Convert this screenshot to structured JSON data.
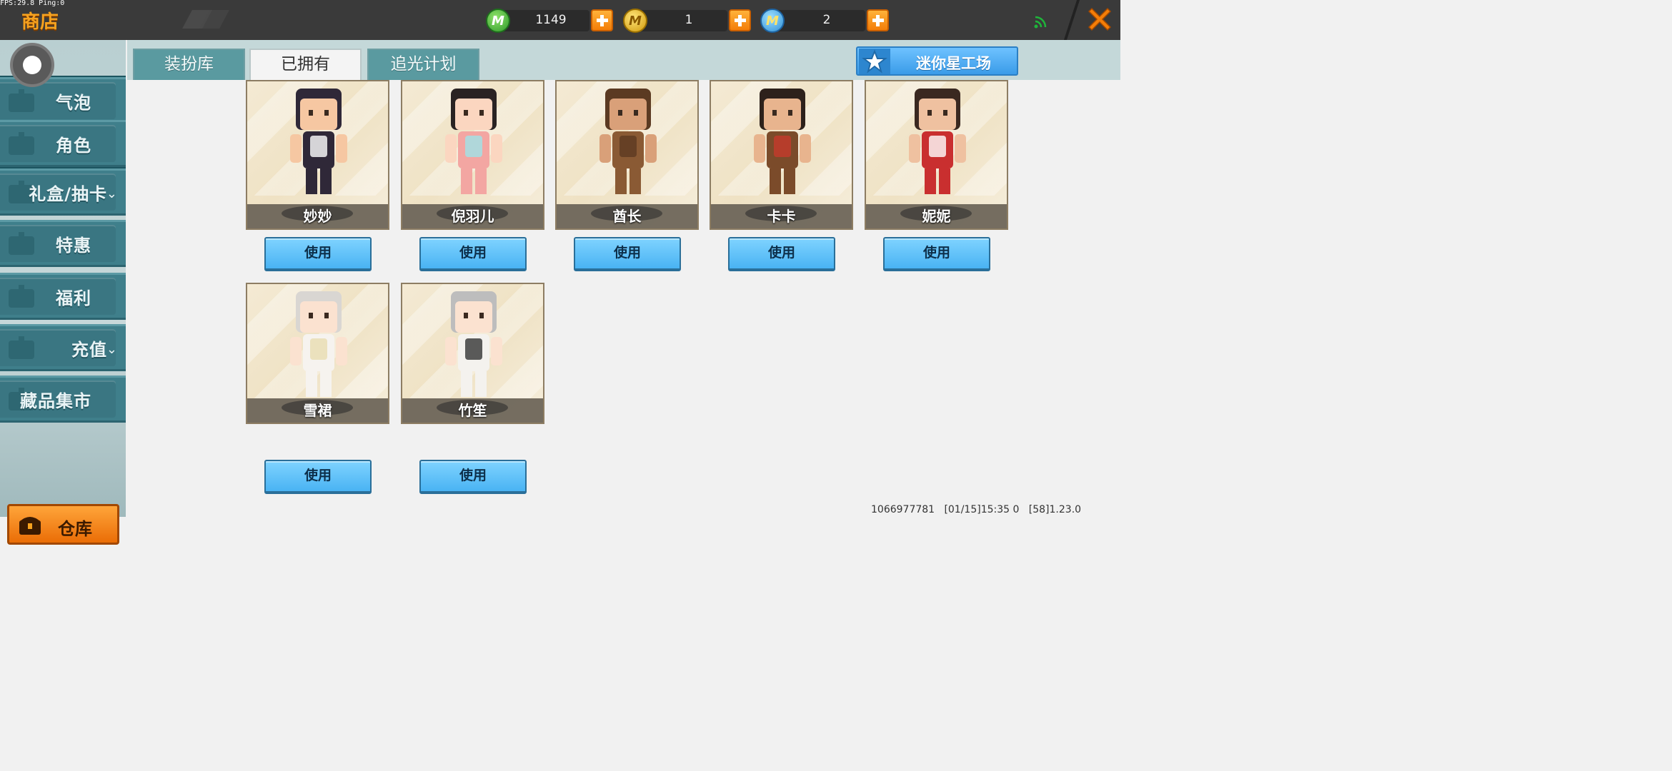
{
  "debug": {
    "fps_text": "FPS:29.8  Ping:0"
  },
  "header": {
    "title": "商店",
    "currencies": [
      {
        "icon": "green-gem-coin-icon",
        "letter": "M",
        "value": "1149",
        "color": "#3db53a"
      },
      {
        "icon": "gold-coin-icon",
        "letter": "M",
        "value": "1",
        "color": "#e8b417"
      },
      {
        "icon": "blue-coin-icon",
        "letter": "M",
        "value": "2",
        "color": "#3aa4e8"
      }
    ]
  },
  "sidebar": {
    "items": [
      {
        "label": "气泡",
        "icon": "gift-box-icon"
      },
      {
        "label": "角色",
        "icon": "character-icon"
      },
      {
        "label": "礼盒/抽卡",
        "icon": "lottery-wheel-icon",
        "expandable": true
      },
      {
        "label": "特惠",
        "icon": "gift-box-icon"
      },
      {
        "label": "福利",
        "icon": "gift-icon"
      },
      {
        "label": "充值",
        "icon": "coins-icon",
        "expandable": true
      },
      {
        "label": "藏品集市",
        "icon": "diamond-icon"
      }
    ],
    "warehouse_label": "仓库"
  },
  "tabs": {
    "items": [
      {
        "label": "装扮库"
      },
      {
        "label": "已拥有",
        "active": true
      },
      {
        "label": "追光计划"
      }
    ],
    "mini_studio_label": "迷你星工场"
  },
  "skins": [
    {
      "name": "妙妙",
      "use_label": "使用",
      "palette": {
        "skin": "#f6c7a2",
        "body": "#2f2838",
        "accent": "#ffffff",
        "hair": "#2f2838"
      }
    },
    {
      "name": "倪羽儿",
      "use_label": "使用",
      "palette": {
        "skin": "#fbd6c0",
        "body": "#f3a6a2",
        "accent": "#9fe3e8",
        "hair": "#2a2323"
      }
    },
    {
      "name": "酋长",
      "use_label": "使用",
      "palette": {
        "skin": "#d9a079",
        "body": "#8a5a34",
        "accent": "#5c3a22",
        "hair": "#5b3a22"
      }
    },
    {
      "name": "卡卡",
      "use_label": "使用",
      "palette": {
        "skin": "#e8b48e",
        "body": "#7b4b2a",
        "accent": "#c63a2c",
        "hair": "#2d211b"
      }
    },
    {
      "name": "妮妮",
      "use_label": "使用",
      "palette": {
        "skin": "#efc1a0",
        "body": "#c92f2f",
        "accent": "#ffffff",
        "hair": "#3a2820"
      }
    },
    {
      "name": "雪裙",
      "use_label": "使用",
      "palette": {
        "skin": "#fbe2d0",
        "body": "#f6f3ef",
        "accent": "#e9dcb0",
        "hair": "#d9d6d2"
      }
    },
    {
      "name": "竹笙",
      "use_label": "使用",
      "palette": {
        "skin": "#fbe2d0",
        "body": "#f4f2ee",
        "accent": "#333333",
        "hair": "#bdbdbd"
      }
    }
  ],
  "footer": {
    "uid": "1066977781",
    "time": "[01/15]15:35 0",
    "version": "[58]1.23.0"
  }
}
